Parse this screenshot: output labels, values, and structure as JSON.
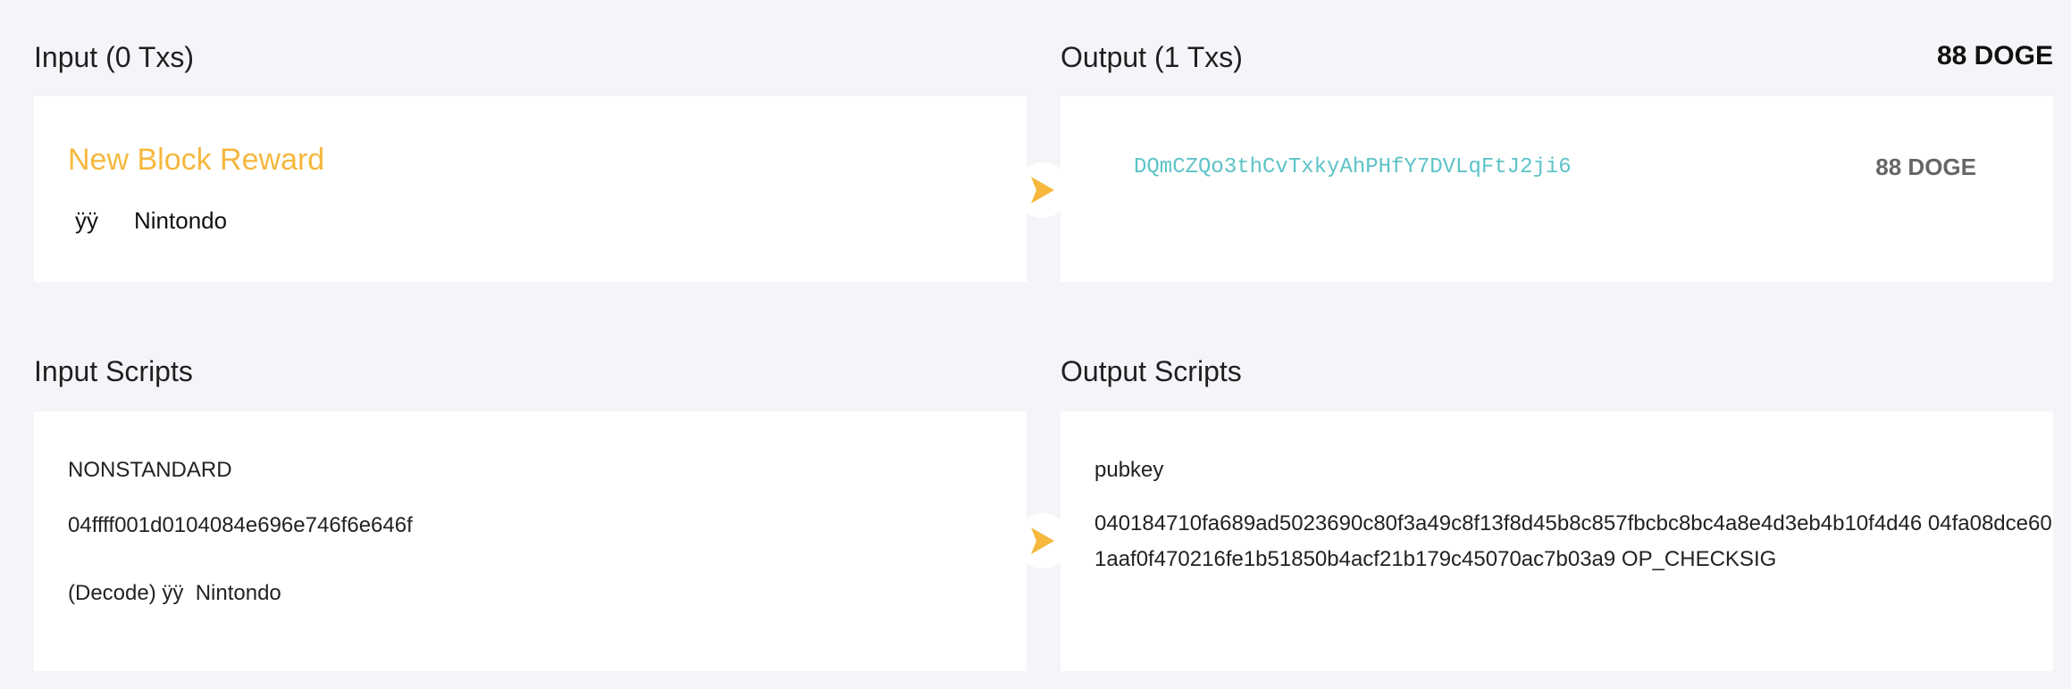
{
  "input_section": {
    "title": "Input (0 Txs)",
    "reward_label": "New Block Reward",
    "coinbase_prefix": "ÿÿ",
    "coinbase_message": "Nintondo"
  },
  "output_section": {
    "title": "Output (1 Txs)",
    "total": "88 DOGE",
    "outputs": [
      {
        "address": "DQmCZQo3thCvTxkyAhPHfY7DVLqFtJ2ji6",
        "amount": "88 DOGE"
      }
    ]
  },
  "input_scripts": {
    "title": "Input Scripts",
    "type": "NONSTANDARD",
    "hex": "04ffff001d0104084e696e746f6e646f",
    "decoded": "(Decode) ÿÿ  Nintondo"
  },
  "output_scripts": {
    "title": "Output Scripts",
    "type": "pubkey",
    "script": "040184710fa689ad5023690c80f3a49c8f13f8d45b8c857fbcbc8bc4a8e4d3eb4b10f4d46 04fa08dce601aaf0f470216fe1b51850b4acf21b179c45070ac7b03a9 OP_CHECKSIG"
  },
  "colors": {
    "accent": "#f5b83d",
    "address": "#5cc3c7",
    "background": "#f4f5f8"
  },
  "icons": {
    "arrow": "arrow-right-icon"
  }
}
